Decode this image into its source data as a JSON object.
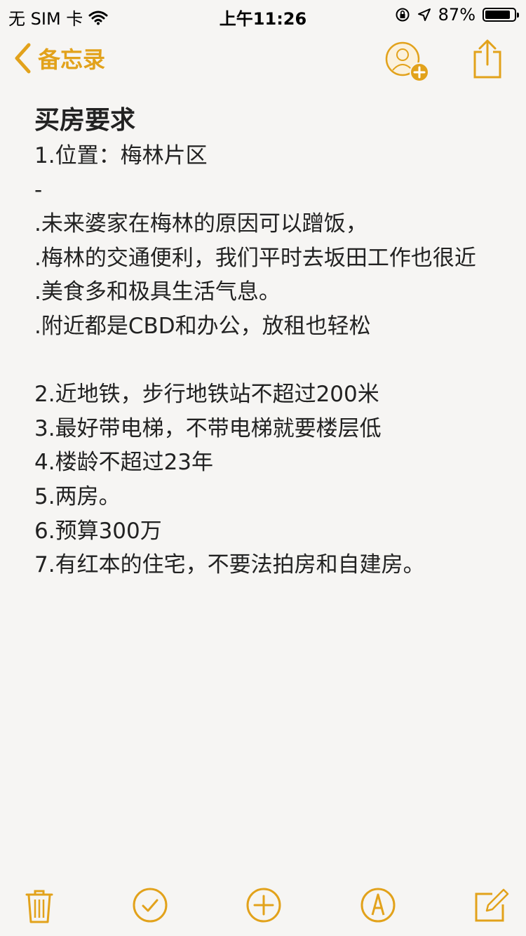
{
  "status_bar": {
    "carrier": "无 SIM 卡",
    "time": "上午11:26",
    "battery_text": "87%",
    "battery_level": 0.87,
    "icons": [
      "wifi-icon",
      "orientation-lock-icon",
      "location-icon",
      "battery-icon"
    ]
  },
  "nav": {
    "back_label": "备忘录",
    "accent_color": "#e2a21b"
  },
  "note": {
    "title": "买房要求",
    "lines": [
      "1.位置：梅林片区",
      "-",
      ".未来婆家在梅林的原因可以蹭饭，",
      ".梅林的交通便利，我们平时去坂田工作也很近",
      ".美食多和极具生活气息。",
      ".附近都是CBD和办公，放租也轻松",
      "",
      "2.近地铁，步行地铁站不超过200米",
      "3.最好带电梯，不带电梯就要楼层低",
      "4.楼龄不超过23年",
      "5.两房。",
      "6.预算300万",
      "7.有红本的住宅，不要法拍房和自建房。"
    ]
  },
  "toolbar": {
    "icons": [
      "trash-icon",
      "checklist-icon",
      "add-icon",
      "markup-icon",
      "compose-icon"
    ]
  }
}
